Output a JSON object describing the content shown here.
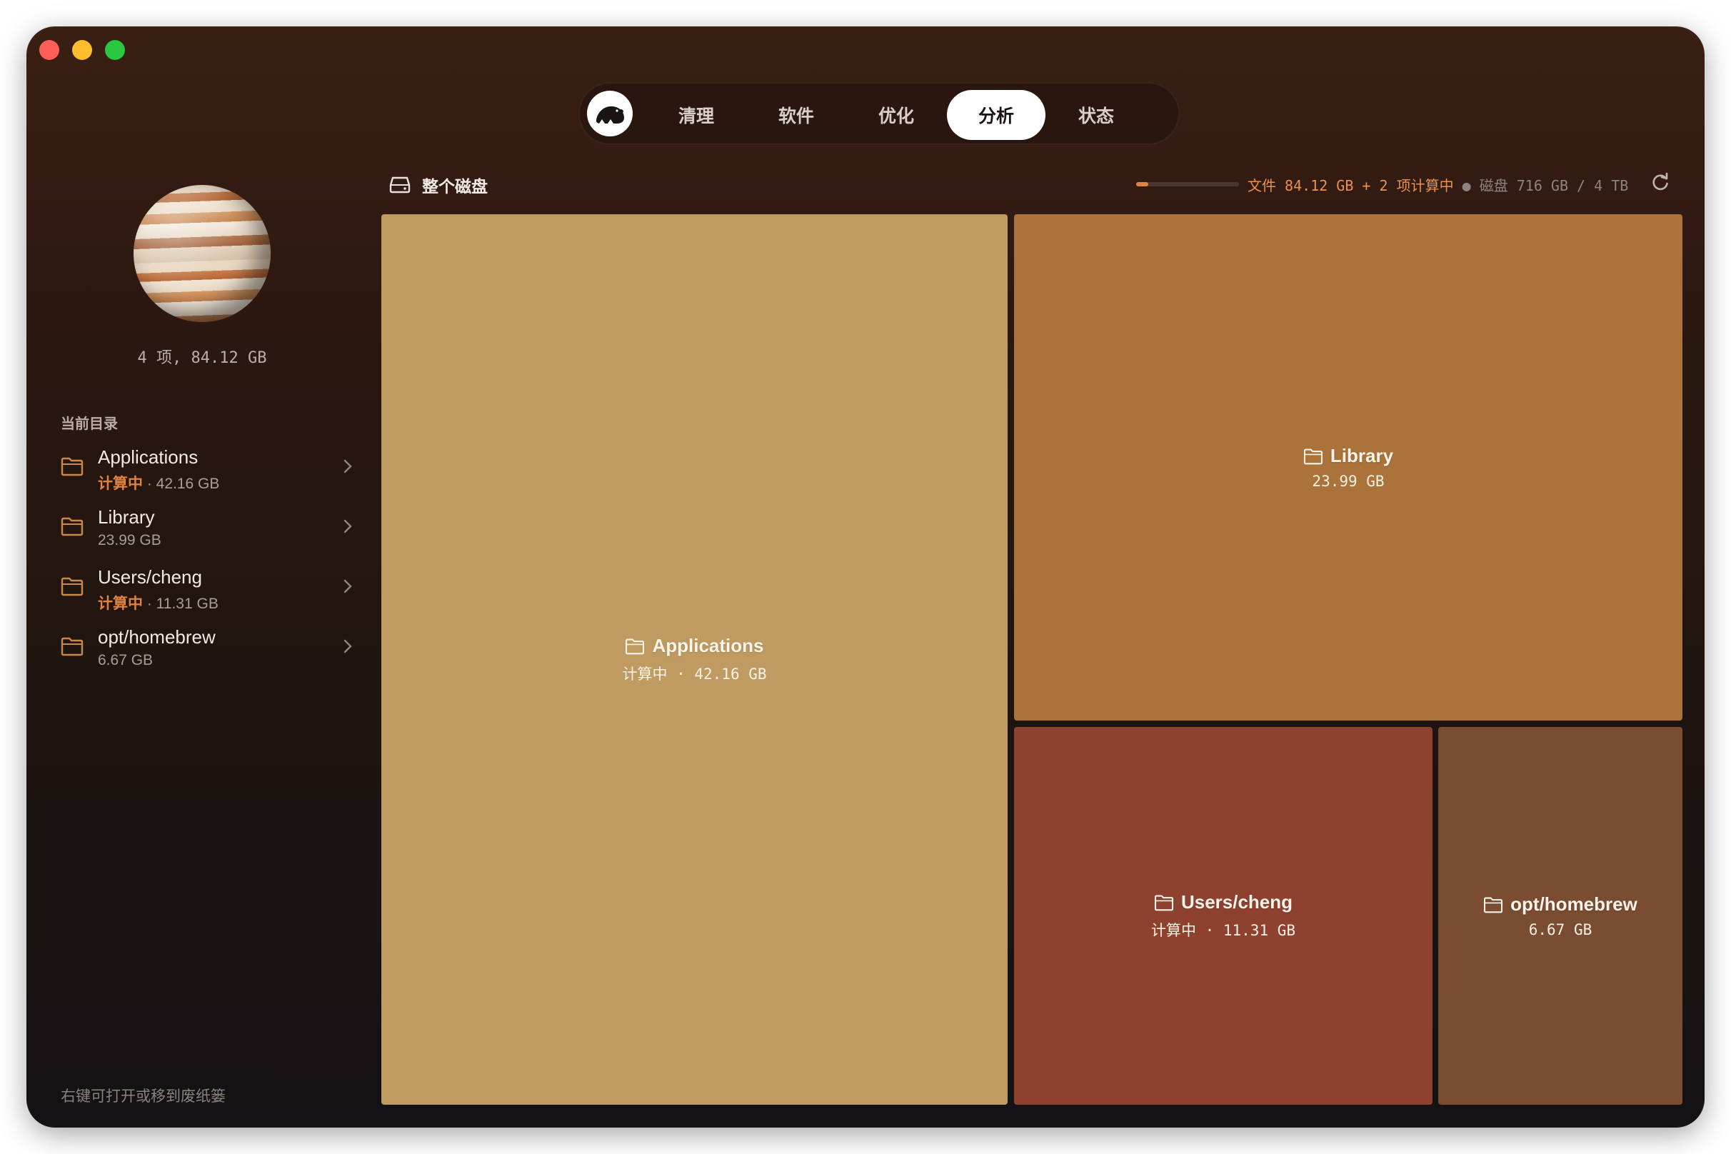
{
  "nav": {
    "tabs": [
      {
        "label": "清理",
        "active": false
      },
      {
        "label": "软件",
        "active": false
      },
      {
        "label": "优化",
        "active": false
      },
      {
        "label": "分析",
        "active": true
      },
      {
        "label": "状态",
        "active": false
      }
    ]
  },
  "sidebar": {
    "summary": "4 项, 84.12 GB",
    "section_title": "当前目录",
    "items": [
      {
        "name": "Applications",
        "status": "计算中",
        "size": "42.16 GB"
      },
      {
        "name": "Library",
        "status": "",
        "size": "23.99 GB"
      },
      {
        "name": "Users/cheng",
        "status": "计算中",
        "size": "11.31 GB"
      },
      {
        "name": "opt/homebrew",
        "status": "",
        "size": "6.67 GB"
      }
    ],
    "footer_hint": "右键可打开或移到废纸篓"
  },
  "header": {
    "title": "整个磁盘",
    "progress": 0.12,
    "files_label": "文件 84.12 GB + 2 项计算中",
    "separator": "●",
    "disk_label": "磁盘 716 GB / 4 TB"
  },
  "treemap": {
    "tiles": [
      {
        "name": "Applications",
        "meta": "计算中 · 42.16 GB",
        "color": "#bf9b62"
      },
      {
        "name": "Library",
        "meta": "23.99 GB",
        "color": "#aa7339"
      },
      {
        "name": "Users/cheng",
        "meta": "计算中 · 11.31 GB",
        "color": "#8f4130"
      },
      {
        "name": "opt/homebrew",
        "meta": "6.67 GB",
        "color": "#7a4c31"
      }
    ]
  },
  "colors": {
    "accent": "#e3823c",
    "tab_active_bg": "#ffffff"
  }
}
